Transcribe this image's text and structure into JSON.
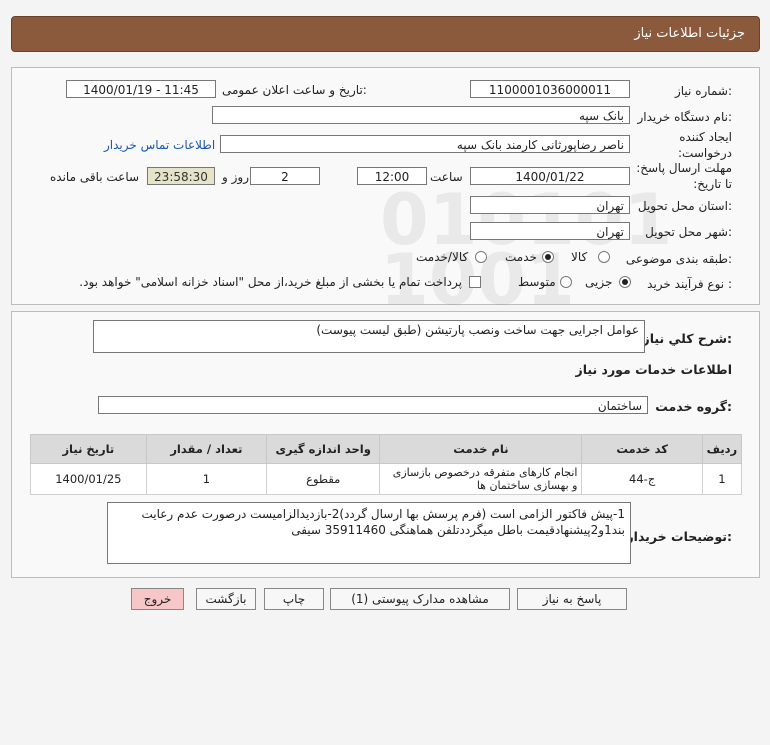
{
  "header": {
    "title": "جزئیات اطلاعات نیاز"
  },
  "form": {
    "need_number_label": "شماره نیاز:",
    "need_number": "1100001036000011",
    "announce_label": "تاریخ و ساعت اعلان عمومی:",
    "announce_value": "1400/01/19 - 11:45",
    "buyer_org_label": "نام دستگاه خریدار:",
    "buyer_org": "بانک سپه",
    "requester_label": "ایجاد کننده درخواست:",
    "requester": "ناصر رضاپورثانی کارمند بانک سپه",
    "contact_link": "اطلاعات تماس خریدار",
    "deadline_label": "مهلت ارسال پاسخ: تا تاریخ:",
    "deadline_date": "1400/01/22",
    "time_label": "ساعت",
    "deadline_time": "12:00",
    "days_value": "2",
    "days_label": "روز و",
    "timer_value": "23:58:30",
    "remaining_label": "ساعت باقی مانده",
    "province_label": "استان محل تحویل:",
    "province": "تهران",
    "city_label": "شهر محل تحویل:",
    "city": "تهران",
    "category_label": "طبقه بندی موضوعی:",
    "category_options": [
      "کالا",
      "خدمت",
      "کالا/خدمت"
    ],
    "category_selected": "خدمت",
    "process_label": "نوع فرآیند خرید :",
    "process_options": [
      "جزیی",
      "متوسط"
    ],
    "process_selected": "جزیی",
    "payment_note": "پرداخت تمام یا بخشی از مبلغ خرید،از محل \"اسناد خزانه اسلامی\" خواهد بود."
  },
  "summary": {
    "label": "شرح کلي نیاز:",
    "value": "عوامل اجرایی جهت ساخت ونصب پارتیشن (طبق لیست پیوست)"
  },
  "services": {
    "section_title": "اطلاعات خدمات مورد نیاز",
    "group_label": "گروه خدمت:",
    "group_value": "ساختمان",
    "columns": [
      "ردیف",
      "کد خدمت",
      "نام خدمت",
      "واحد اندازه گیری",
      "تعداد / مقدار",
      "تاریخ نیاز"
    ],
    "rows": [
      {
        "row": "1",
        "code": "ج-44",
        "name": "انجام کارهای متفرقه درخصوص بازسازی و بهسازی ساختمان ها",
        "unit": "مقطوع",
        "qty": "1",
        "date": "1400/01/25"
      }
    ]
  },
  "buyer_notes": {
    "label": "توضیحات خریدار:",
    "value": "1-پیش فاکتور الزامی است (فرم پرسش بها ارسال گردد)2-بازدیدالزامیست درصورت عدم رعایت بند1و2پیشنهادقیمت باطل میگرددتلفن هماهنگی 35911460 سیفی"
  },
  "buttons": {
    "reply": "پاسخ به نیاز",
    "view_docs": "مشاهده مدارک پیوستی (1)",
    "print": "چاپ",
    "back": "بازگشت",
    "exit": "خروج"
  },
  "colors": {
    "header_bg": "#8b5a3c",
    "timer_bg": "#e6e4c8",
    "exit_bg": "#f7c7c7",
    "link": "#1a55b0"
  }
}
